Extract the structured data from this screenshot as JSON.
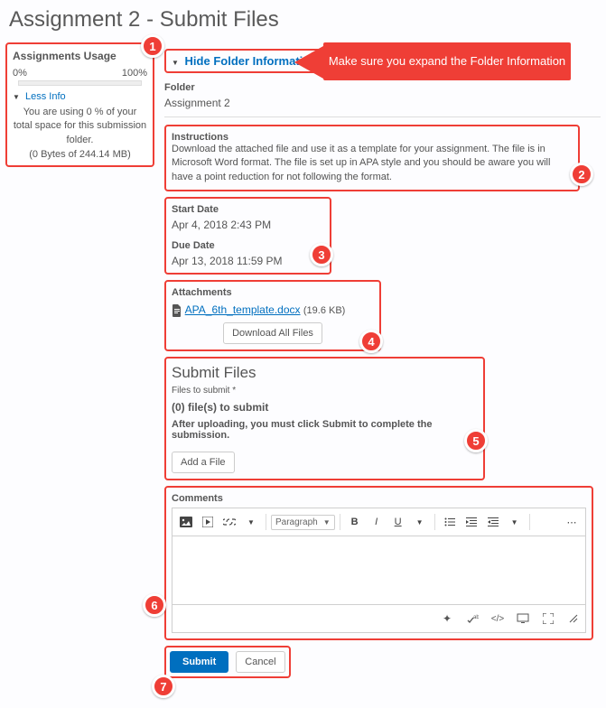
{
  "page_title": "Assignment 2 - Submit Files",
  "callout": "Make sure you expand the Folder Information",
  "sidebar": {
    "heading": "Assignments Usage",
    "pct_start": "0%",
    "pct_end": "100%",
    "less_info": "Less Info",
    "usage_text": "You are using 0 % of your total space for this submission folder.",
    "usage_bytes": "(0 Bytes of 244.14 MB)"
  },
  "hide_folder": "Hide Folder Information",
  "folder_label": "Folder",
  "folder_value": "Assignment 2",
  "instructions_label": "Instructions",
  "instructions_text": "Download the attached file and use it as a template for your assignment. The file is in Microsoft Word format. The file is set up in APA style and you should be aware you will have a point reduction for not following the format.",
  "dates": {
    "start_label": "Start Date",
    "start_value": "Apr 4, 2018 2:43 PM",
    "due_label": "Due Date",
    "due_value": "Apr 13, 2018 11:59 PM"
  },
  "attachments": {
    "label": "Attachments",
    "file_name": "APA_6th_template.docx",
    "file_size": "(19.6 KB)",
    "download_all": "Download All Files"
  },
  "submit": {
    "heading": "Submit Files",
    "files_label": "Files to submit *",
    "count": "(0) file(s) to submit",
    "warn": "After uploading, you must click Submit to complete the submission.",
    "add_file": "Add a File"
  },
  "comments": {
    "label": "Comments",
    "paragraph": "Paragraph"
  },
  "actions": {
    "submit": "Submit",
    "cancel": "Cancel"
  },
  "markers": {
    "1": "1",
    "2": "2",
    "3": "3",
    "4": "4",
    "5": "5",
    "6": "6",
    "7": "7"
  }
}
